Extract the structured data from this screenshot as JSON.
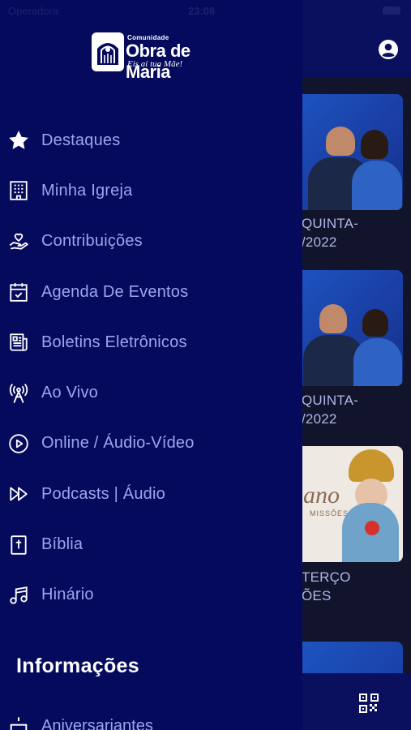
{
  "status_bar": {
    "carrier": "Operadora",
    "time": "23:08"
  },
  "drawer": {
    "logo": {
      "small_text": "Comunidade",
      "name": "Obra de Maria",
      "tagline": "Eis aí tua Mãe!"
    },
    "menu": [
      {
        "label": "Destaques",
        "icon": "star-icon"
      },
      {
        "label": "Minha Igreja",
        "icon": "building-icon"
      },
      {
        "label": "Contribuições",
        "icon": "donation-hand-icon"
      },
      {
        "label": "Agenda De Eventos",
        "icon": "calendar-check-icon"
      },
      {
        "label": "Boletins Eletrônicos",
        "icon": "newspaper-icon"
      },
      {
        "label": "Ao Vivo",
        "icon": "broadcast-antenna-icon"
      },
      {
        "label": "Online / Áudio-Vídeo",
        "icon": "play-circle-icon"
      },
      {
        "label": "Podcasts | Áudio",
        "icon": "fast-forward-icon"
      },
      {
        "label": "Bíblia",
        "icon": "bible-icon"
      },
      {
        "label": "Hinário",
        "icon": "music-note-icon"
      }
    ],
    "section_title": "Informações",
    "section_items": [
      {
        "label": "Aniversariantes",
        "icon": "cake-icon"
      }
    ]
  },
  "background": {
    "cards": [
      {
        "line1": "QUINTA-",
        "line2": "/2022"
      },
      {
        "line1": "QUINTA-",
        "line2": "/2022"
      },
      {
        "line1": "TERÇO",
        "line2": "ÕES",
        "image_text": "ano",
        "image_subtext": "MISSÕES"
      }
    ]
  },
  "colors": {
    "drawer_bg": "#050a5c",
    "menu_text": "#9da5ee",
    "header_bg": "#0a0f5e",
    "app_bg": "#12142c"
  }
}
